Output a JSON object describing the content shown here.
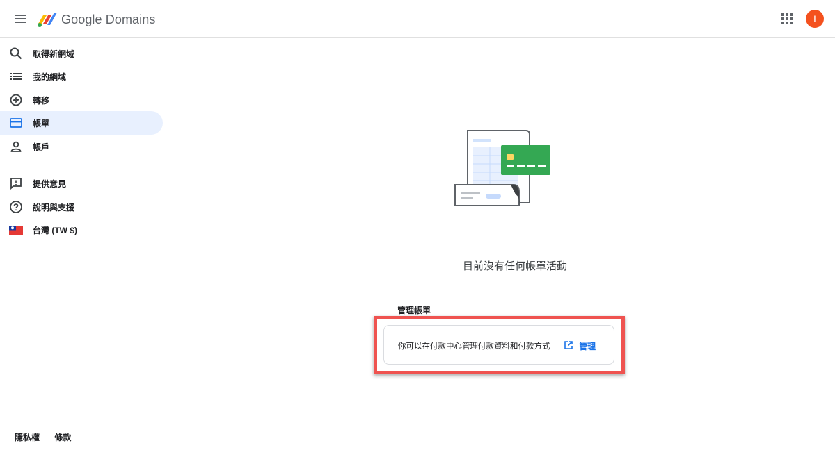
{
  "header": {
    "brand": "Google Domains",
    "avatar_initial": "I"
  },
  "sidebar": {
    "items": [
      {
        "label": "取得新網域",
        "icon": "search-icon"
      },
      {
        "label": "我的網域",
        "icon": "list-icon"
      },
      {
        "label": "轉移",
        "icon": "transfer-icon"
      },
      {
        "label": "帳單",
        "icon": "credit-card-icon",
        "active": true
      },
      {
        "label": "帳戶",
        "icon": "person-icon"
      }
    ],
    "secondary": [
      {
        "label": "提供意見",
        "icon": "feedback-icon"
      },
      {
        "label": "說明與支援",
        "icon": "help-icon"
      },
      {
        "label": "台灣 (TW $)",
        "icon": "taiwan-flag-icon"
      }
    ]
  },
  "footer": {
    "privacy": "隱私權",
    "terms": "條款"
  },
  "main": {
    "empty_title": "目前沒有任何帳單活動",
    "section_label": "管理帳單",
    "card_text": "你可以在付款中心管理付款資料和付款方式",
    "manage_label": "管理"
  },
  "colors": {
    "accent": "#1a73e8",
    "active_bg": "#e8f0fe",
    "avatar": "#f4511e",
    "highlight": "#ef5350",
    "card_green": "#34a853"
  }
}
